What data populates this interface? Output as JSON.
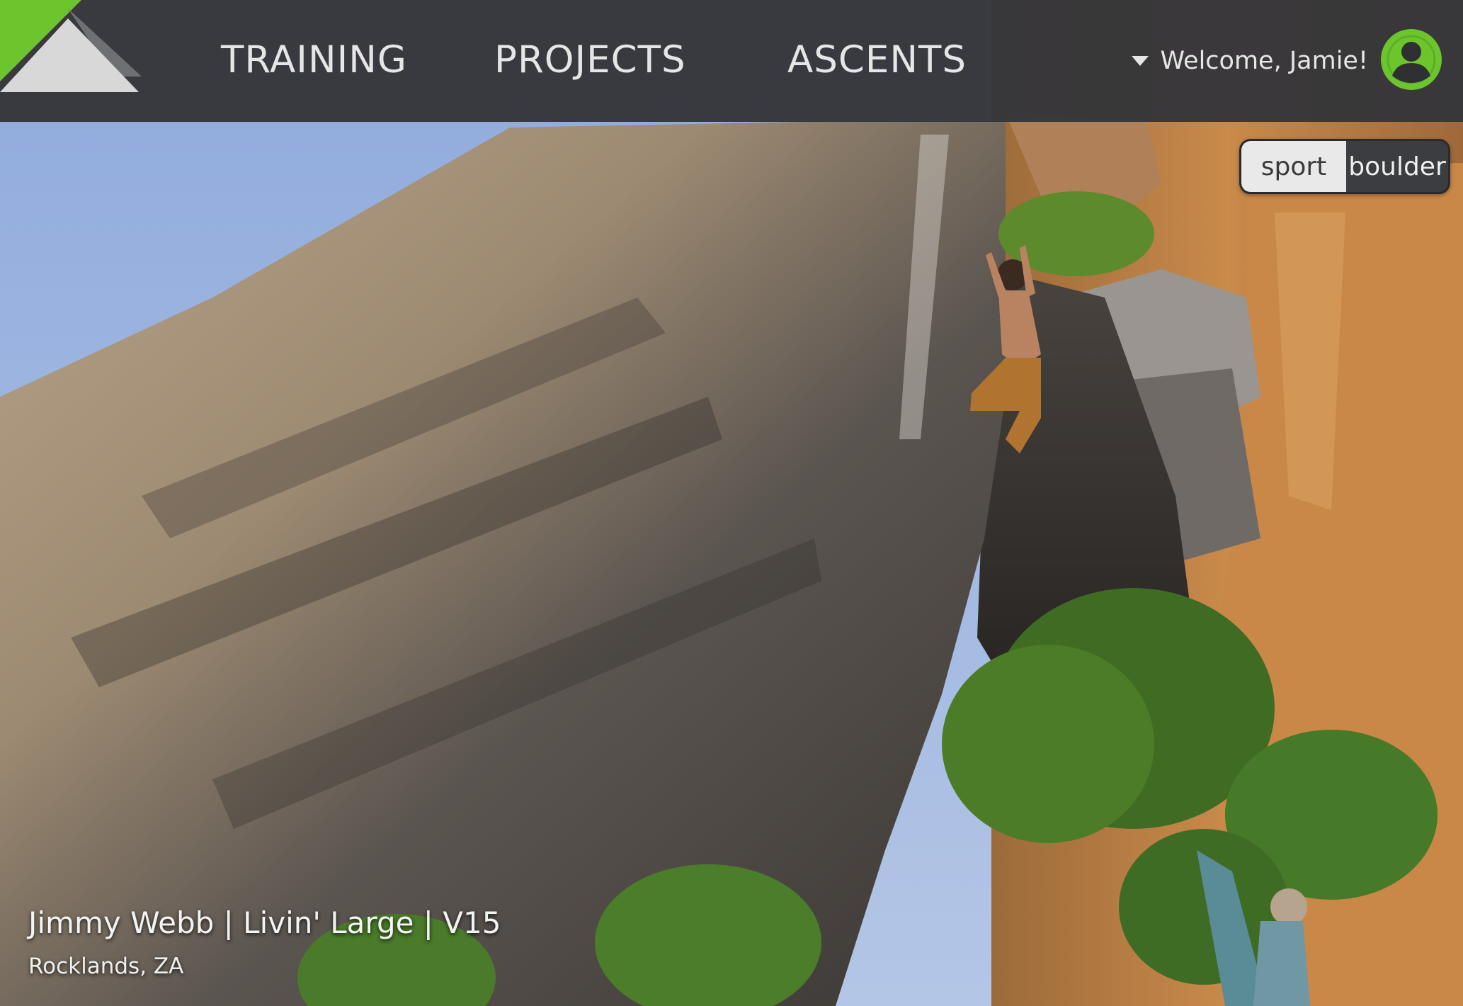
{
  "nav": {
    "links": [
      {
        "label": "TRAINING"
      },
      {
        "label": "PROJECTS"
      },
      {
        "label": "ASCENTS"
      }
    ],
    "user_menu": {
      "label": "Welcome, Jamie!",
      "icon": "caret-down-icon"
    },
    "avatar_icon": "user-avatar-icon"
  },
  "discipline_toggle": {
    "options": [
      {
        "label": "sport",
        "selected": true
      },
      {
        "label": "boulder",
        "selected": false
      }
    ]
  },
  "hero": {
    "caption_title": "Jimmy Webb | Livin' Large | V15",
    "caption_location": "Rocklands, ZA"
  },
  "colors": {
    "accent_green": "#6cc52d",
    "navbar_bg": "#343539",
    "nav_text": "#e6e6e6"
  }
}
